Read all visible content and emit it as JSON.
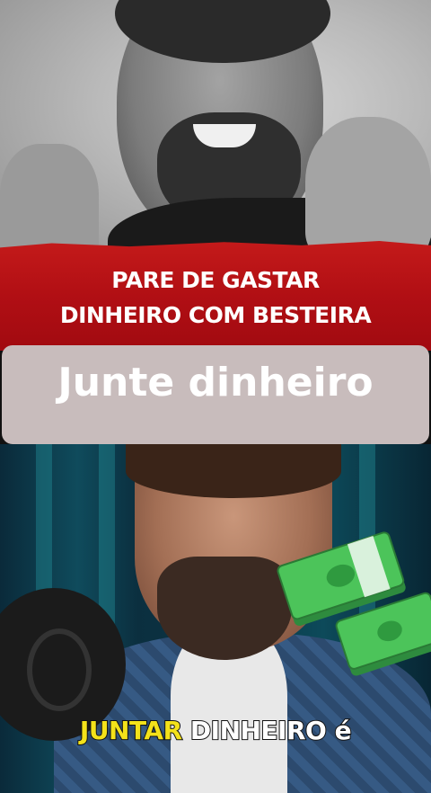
{
  "banner": {
    "line1": "PARE DE GASTAR",
    "line2": "DINHEIRO COM BESTEIRA",
    "color": "#b10f14"
  },
  "caption": {
    "text": "Junte dinheiro",
    "box_color": "#c8bcbc"
  },
  "subtitle": {
    "word1": "JUNTAR",
    "word2": "DINHEIRO",
    "word3": "é",
    "highlight_color": "#f4e21a"
  },
  "stickers": {
    "money_icon": "money-stack-icon"
  }
}
